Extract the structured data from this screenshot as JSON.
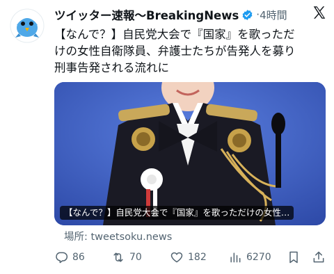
{
  "tweet": {
    "author_name": "ツイッター速報〜BreakingNews",
    "separator": "·",
    "time": "4時間",
    "body_lines": [
      "【なんで？】自民党大会で『国家』を歌っただ",
      "けの女性自衛隊員、弁護士たちが告発人を募り",
      "刑事告発される流れに"
    ],
    "media_caption": "【なんで？】自民党大会で『国家』を歌っただけの女性…",
    "source_label": "場所: tweetsoku.news"
  },
  "actions": {
    "replies": "86",
    "retweets": "70",
    "likes": "182",
    "views": "6270"
  },
  "colors": {
    "verified": "#1d9bf0",
    "muted": "#536471",
    "text": "#0f1419",
    "media_bg": "#3a57b8",
    "avatar_bird": "#4fa8e8"
  },
  "icons": {
    "verified": "verified-badge-icon",
    "x": "x-logo-icon",
    "reply": "reply-icon",
    "retweet": "retweet-icon",
    "like": "heart-icon",
    "views": "views-icon",
    "bookmark": "bookmark-icon",
    "share": "share-icon"
  }
}
